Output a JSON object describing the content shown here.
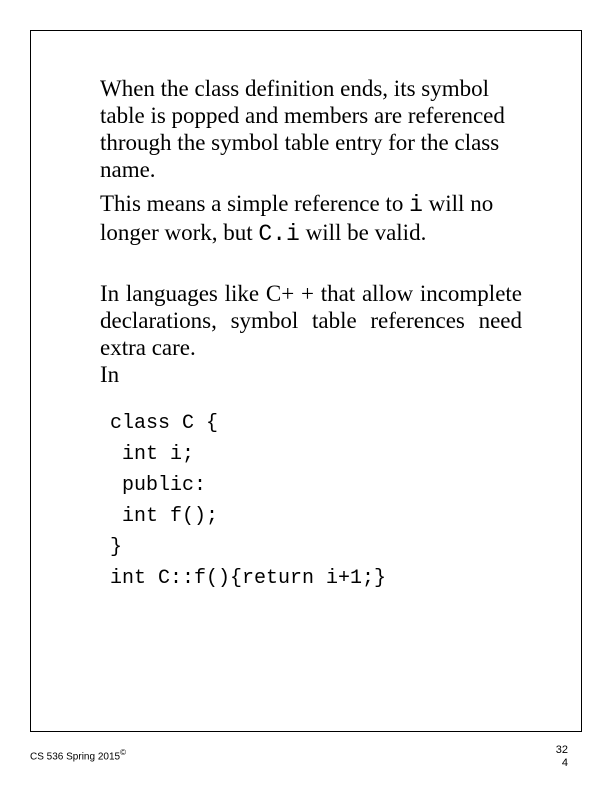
{
  "paragraphs": {
    "p1": "When the class definition ends, its symbol table is popped and members are referenced through the symbol table entry for the class name.",
    "p2_a": "This means a simple reference to ",
    "p2_code1": "i",
    "p2_b": " will no longer work, but ",
    "p2_code2": "C.i",
    "p2_c": " will be valid.",
    "p3": "In languages like C+ +  that allow incomplete declarations, symbol table references need extra care.",
    "p3b": "In"
  },
  "code": {
    "l1": "class C {",
    "l2": " int i;",
    "l3": " public:",
    "l4": " int f();",
    "l5": "}",
    "l6": "int C::f(){return i+1;}"
  },
  "footer": {
    "left": "CS 536  Spring 2015",
    "copyright": "©",
    "right1": "32",
    "right2": "4"
  }
}
